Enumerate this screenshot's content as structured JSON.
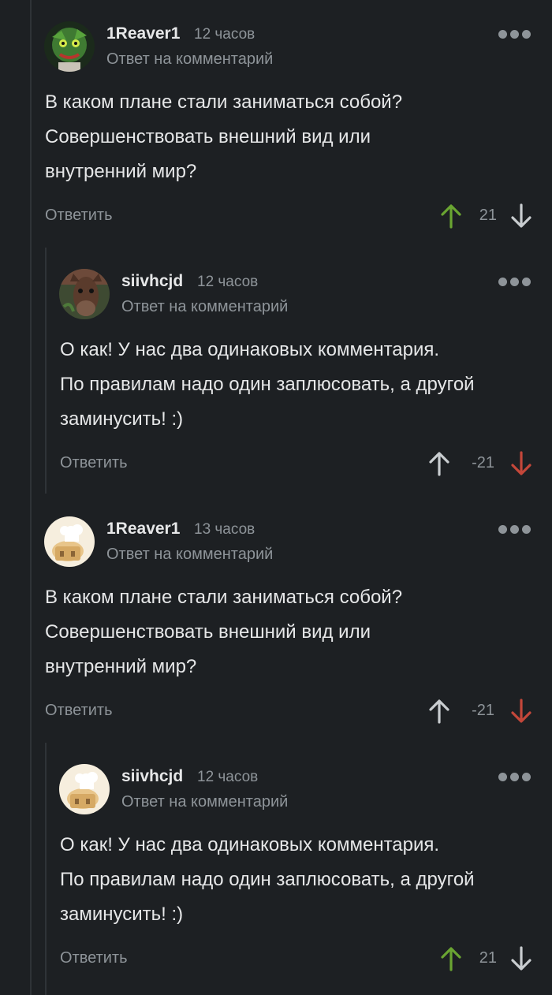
{
  "colors": {
    "background": "#1d2023",
    "text": "#e6e7e8",
    "muted": "#8e9499",
    "upvote_active": "#6aa532",
    "downvote_active": "#c4473a"
  },
  "comments": [
    {
      "author": "1Reaver1",
      "time": "12 часов",
      "reply_to": "Ответ на комментарий",
      "text": "В каком плане стали заниматься собой?\nСовершенствовать внешний вид или\nвнутренний мир?",
      "reply_label": "Ответить",
      "rating": "21",
      "vote": "up",
      "avatar_icon": "green-character-avatar-icon"
    },
    {
      "author": "siivhcjd",
      "time": "12 часов",
      "reply_to": "Ответ на комментарий",
      "text": "О как! У нас два одинаковых комментария.\nПо правилам надо один заплюсовать, а другой\nзаминусить! :)",
      "reply_label": "Ответить",
      "rating": "-21",
      "vote": "down",
      "avatar_icon": "horse-avatar-icon"
    },
    {
      "author": "1Reaver1",
      "time": "13 часов",
      "reply_to": "Ответ на комментарий",
      "text": "В каком плане стали заниматься собой?\nСовершенствовать внешний вид или\nвнутренний мир?",
      "reply_label": "Ответить",
      "rating": "-21",
      "vote": "down",
      "avatar_icon": "default-chef-avatar-icon"
    },
    {
      "author": "siivhcjd",
      "time": "12 часов",
      "reply_to": "Ответ на комментарий",
      "text": "О как! У нас два одинаковых комментария.\nПо правилам надо один заплюсовать, а другой\nзаминусить! :)",
      "reply_label": "Ответить",
      "rating": "21",
      "vote": "up",
      "avatar_icon": "default-chef-avatar-icon"
    }
  ]
}
